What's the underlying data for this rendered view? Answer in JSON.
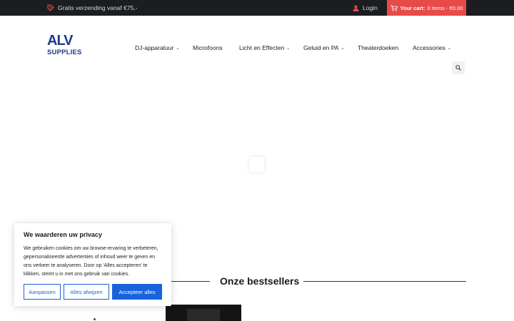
{
  "topbar": {
    "shipping_text": "Gratis verzending vanaf €75,-",
    "login_label": "Login",
    "cart_label": "Your cart:",
    "cart_summary": "0 Items - €0.00"
  },
  "logo": {
    "top": "ALV",
    "bottom": "SUPPLIES"
  },
  "nav": {
    "items": [
      {
        "label": "DJ-apparatuur",
        "has_dropdown": true
      },
      {
        "label": "Microfoons",
        "has_dropdown": false
      },
      {
        "label": "Licht en Effecten",
        "has_dropdown": true
      },
      {
        "label": "Geluid en PA",
        "has_dropdown": true
      },
      {
        "label": "Theaterdoeken",
        "has_dropdown": false
      },
      {
        "label": "Accessories",
        "has_dropdown": true
      }
    ],
    "dropdown_glyph": "⌄"
  },
  "section": {
    "title": "Onze bestsellers"
  },
  "cookie": {
    "title": "We waarderen uw privacy",
    "text": "We gebruiken cookies om uw browse-ervaring te verbeteren, gepersonaliseerde advertenties of inhoud weer te geven en ons verkeer te analyseren. Door op 'Alles accepteren' te klikken, stemt u in met ons gebruik van cookies.",
    "customize_label": "Aanpassen",
    "reject_label": "Alles afwijzen",
    "accept_label": "Accepteer alles"
  },
  "colors": {
    "topbar_bg": "#1b1d21",
    "cart_bg": "#e84a4a",
    "accent_icon": "#e84a4a",
    "logo_blue": "#1d3a8a",
    "cookie_button_blue": "#1863dc"
  },
  "icons": {
    "shipping": "tag-percent-icon",
    "login": "user-icon",
    "cart": "cart-icon",
    "search": "search-icon"
  }
}
